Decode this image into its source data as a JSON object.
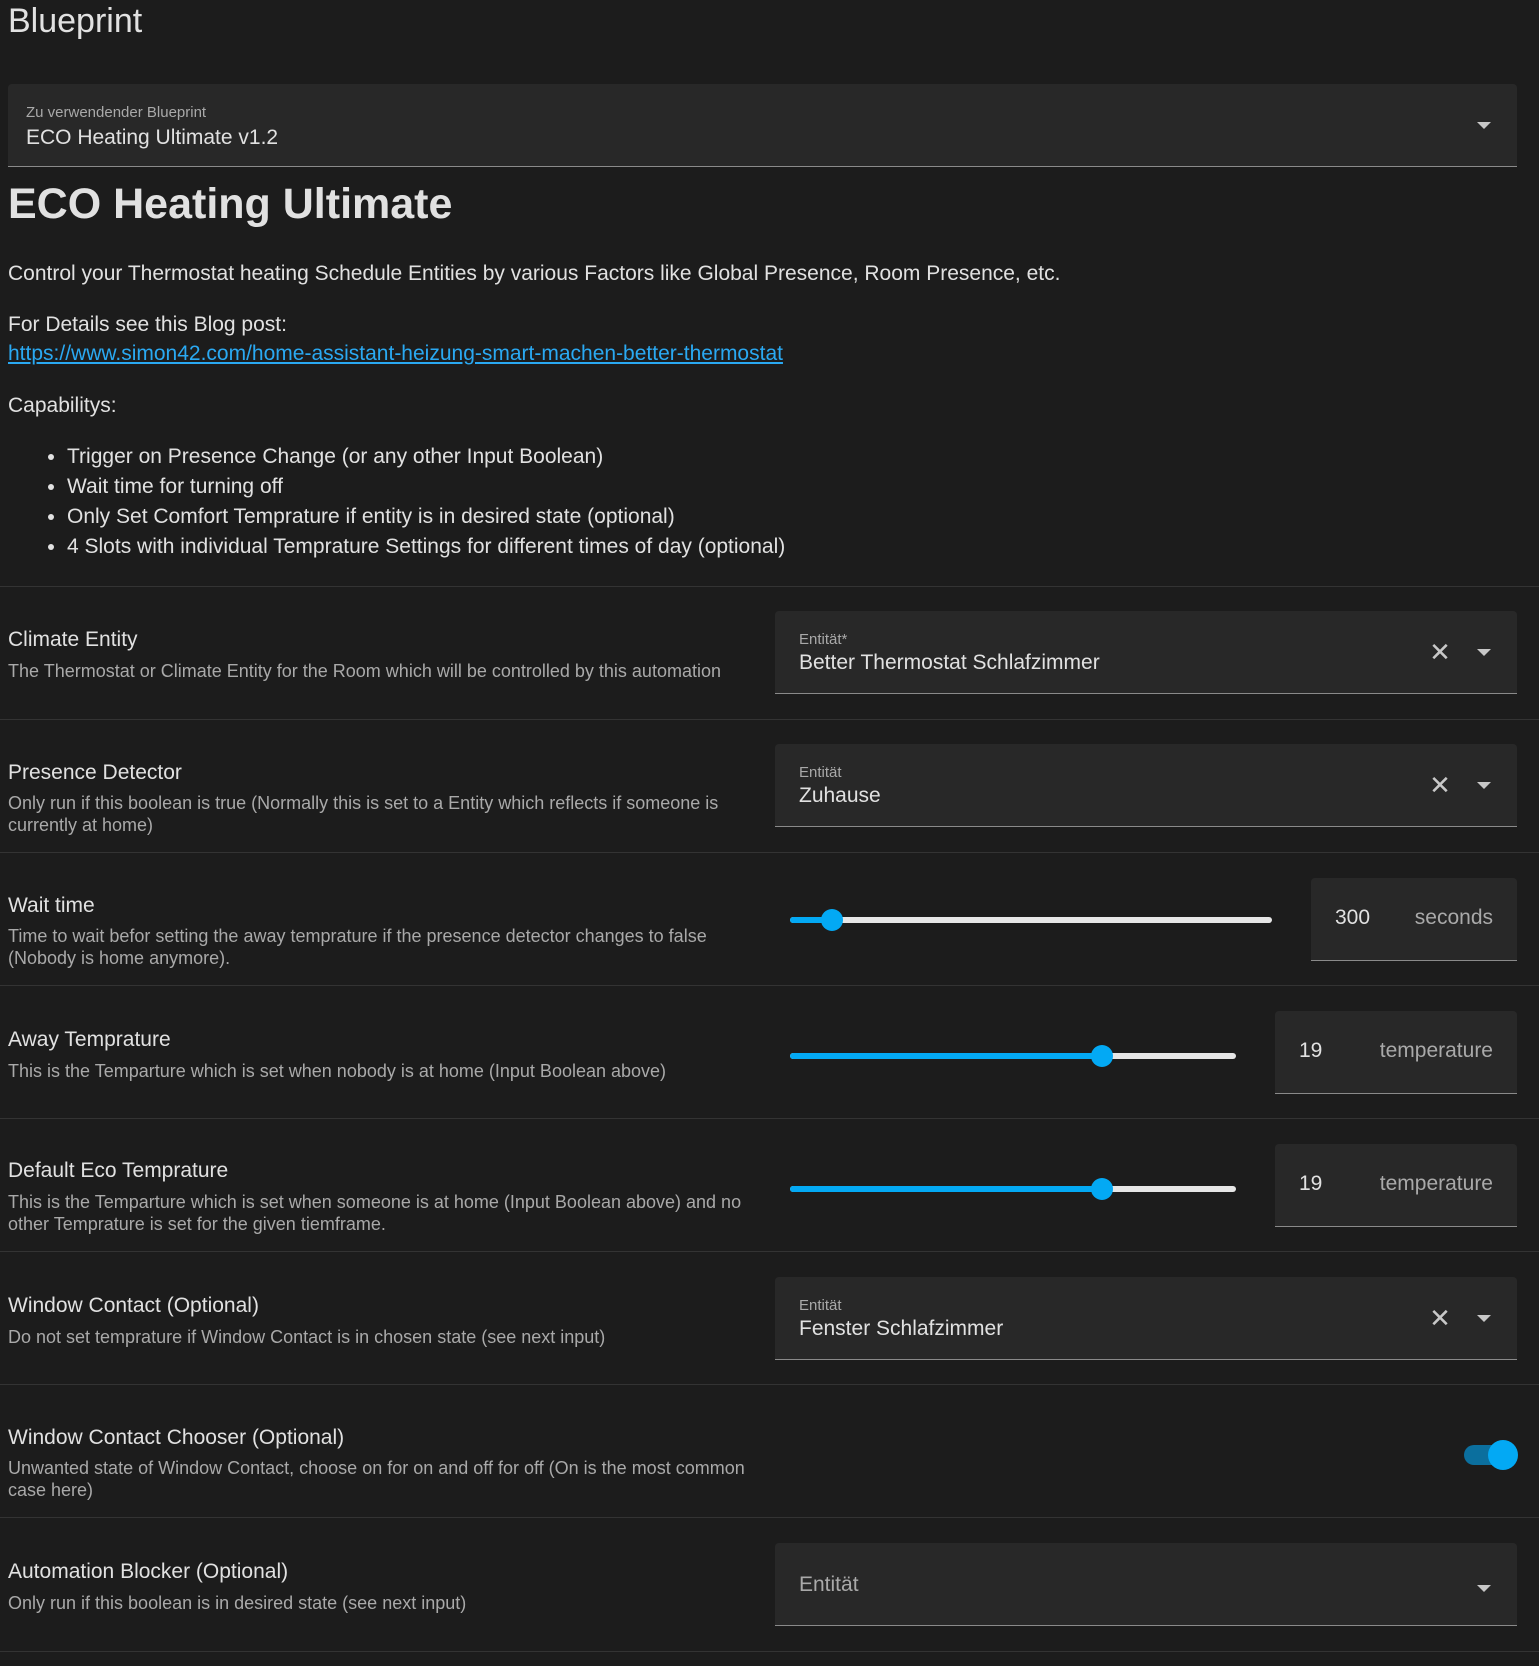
{
  "header": {
    "title": "Blueprint"
  },
  "blueprint_select": {
    "label": "Zu verwendender Blueprint",
    "value": "ECO Heating Ultimate v1.2"
  },
  "blueprint": {
    "name": "ECO Heating Ultimate",
    "description": "Control your Thermostat heating Schedule Entities by various Factors like Global Presence, Room Presence, etc.",
    "details_label": "For Details see this Blog post:",
    "link": "https://www.simon42.com/home-assistant-heizung-smart-machen-better-thermostat",
    "capabilities_label": "Capabilitys:",
    "capabilities": [
      "Trigger on Presence Change (or any other Input Boolean)",
      "Wait time for turning off",
      "Only Set Comfort Temprature if entity is in desired state (optional)",
      "4 Slots with individual Temprature Settings for different times of day (optional)"
    ]
  },
  "inputs": {
    "climate_entity": {
      "title": "Climate Entity",
      "description": "The Thermostat or Climate Entity for the Room which will be controlled by this automation",
      "field_label": "Entität*",
      "value": "Better Thermostat Schlafzimmer"
    },
    "presence_detector": {
      "title": "Presence Detector",
      "description": "Only run if this boolean is true (Normally this is set to a Entity which reflects if someone is currently at home)",
      "field_label": "Entität",
      "value": "Zuhause"
    },
    "wait_time": {
      "title": "Wait time",
      "description": "Time to wait befor setting the away temprature if the presence detector changes to false (Nobody is home anymore).",
      "value": "300",
      "unit": "seconds",
      "slider_fraction": 0.088
    },
    "away_temperature": {
      "title": "Away Temprature",
      "description": "This is the Temparture which is set when nobody is at home (Input Boolean above)",
      "value": "19",
      "unit": "temperature",
      "slider_fraction": 0.7
    },
    "default_eco_temperature": {
      "title": "Default Eco Temprature",
      "description": "This is the Temparture which is set when someone is at home (Input Boolean above) and no other Temprature is set for the given tiemframe.",
      "value": "19",
      "unit": "temperature",
      "slider_fraction": 0.7
    },
    "window_contact": {
      "title": "Window Contact (Optional)",
      "description": "Do not set temprature if Window Contact is in chosen state (see next input)",
      "field_label": "Entität",
      "value": "Fenster Schlafzimmer"
    },
    "window_contact_chooser": {
      "title": "Window Contact Chooser (Optional)",
      "description": "Unwanted state of Window Contact, choose on for on and off for off (On is the most common case here)",
      "toggle_on": true
    },
    "automation_blocker": {
      "title": "Automation Blocker (Optional)",
      "description": "Only run if this boolean is in desired state (see next input)",
      "placeholder": "Entität"
    }
  },
  "colors": {
    "background": "#1c1c1c",
    "field_background": "#282828",
    "accent": "#03a9f4",
    "link": "#2aa9f2"
  }
}
